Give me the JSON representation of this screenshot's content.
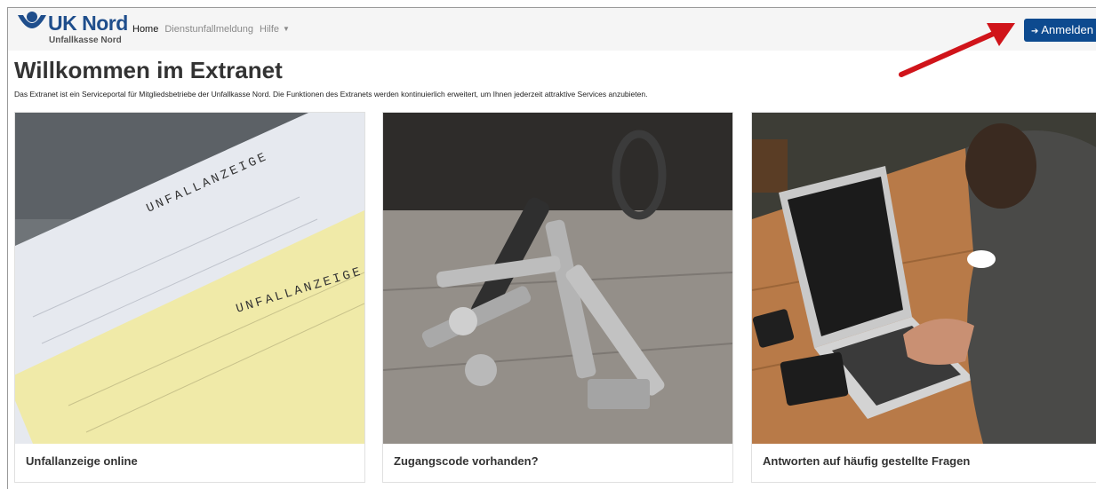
{
  "brand": {
    "name": "UK Nord",
    "subtitle": "Unfallkasse Nord",
    "color": "#1f4e8c"
  },
  "nav": {
    "home": "Home",
    "report": "Dienstunfallmeldung",
    "help": "Hilfe"
  },
  "login": {
    "label": "Anmelden",
    "color": "#0d4a8f"
  },
  "page": {
    "title": "Willkommen im Extranet",
    "intro": "Das Extranet ist ein Serviceportal für Mitgliedsbetriebe der Unfallkasse Nord. Die Funktionen des Extranets werden kontinuierlich erweitert, um Ihnen jederzeit attraktive Services anzubieten."
  },
  "cards": [
    {
      "title": "Unfallanzeige online",
      "image_text": {
        "form_heading_1": "UNFALLANZEIGE",
        "form_heading_2": "UNFALLANZEIGE"
      }
    },
    {
      "title": "Zugangscode vorhanden?"
    },
    {
      "title": "Antworten auf häufig gestellte Fragen"
    }
  ],
  "annotation_color": "#d0141a"
}
